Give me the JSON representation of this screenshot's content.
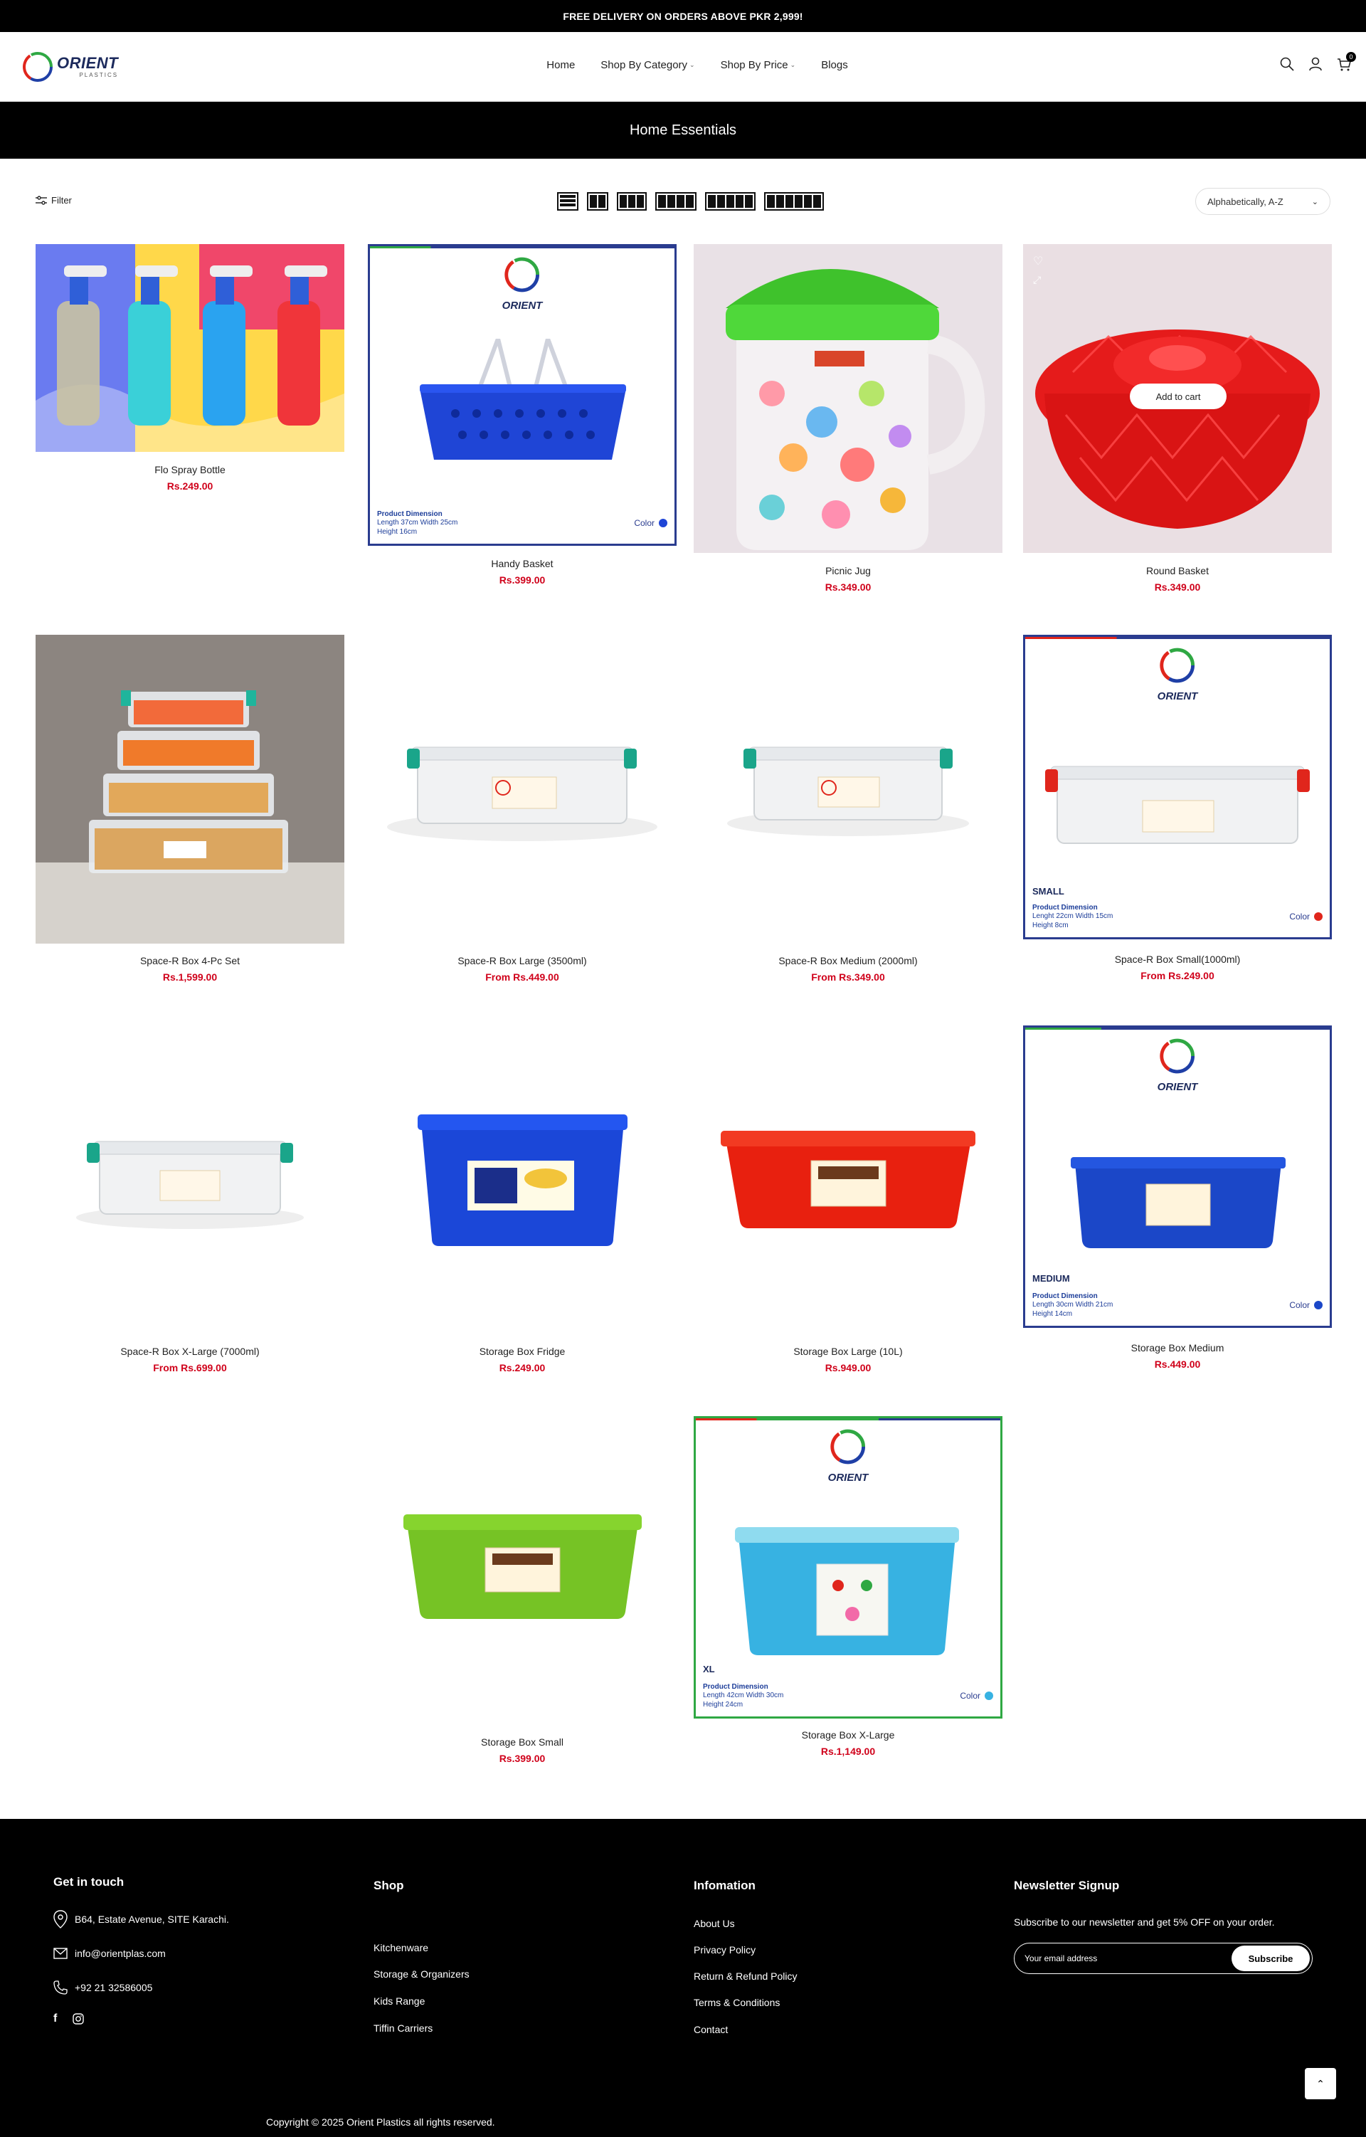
{
  "announcement": "FREE DELIVERY ON ORDERS ABOVE PKR 2,999!",
  "logo": {
    "word": "ORIENT",
    "sub": "PLASTICS"
  },
  "nav": [
    {
      "label": "Home"
    },
    {
      "label": "Shop By Category"
    },
    {
      "label": "Shop By Price"
    },
    {
      "label": "Blogs"
    }
  ],
  "cart_count": "0",
  "collection_title": "Home Essentials",
  "toolbar": {
    "filter_label": "Filter",
    "sort_value": "Alphabetically, A-Z"
  },
  "products": [
    {
      "name": "Flo Spray Bottle",
      "price": "Rs.249.00"
    },
    {
      "name": "Handy Basket",
      "price": "Rs.399.00",
      "dim_title": "Product Dimension",
      "dim_line1": "Length 37cm Width 25cm",
      "dim_line2": "Height 16cm",
      "color_label": "Color"
    },
    {
      "name": "Picnic Jug",
      "price": "Rs.349.00"
    },
    {
      "name": "Round Basket",
      "price": "Rs.349.00",
      "cta": "Add to cart"
    },
    {
      "name": "Space-R Box 4-Pc Set",
      "price": "Rs.1,599.00"
    },
    {
      "name": "Space-R Box Large (3500ml)",
      "price": "From Rs.449.00"
    },
    {
      "name": "Space-R Box Medium (2000ml)",
      "price": "From Rs.349.00"
    },
    {
      "name": "Space-R Box Small(1000ml)",
      "price": "From Rs.249.00",
      "size": "SMALL",
      "dim_title": "Product Dimension",
      "dim_line1": "Lenght 22cm Width 15cm",
      "dim_line2": "Height 8cm",
      "color_label": "Color"
    },
    {
      "name": "Space-R Box X-Large (7000ml)",
      "price": "From Rs.699.00"
    },
    {
      "name": "Storage Box Fridge",
      "price": "Rs.249.00"
    },
    {
      "name": "Storage Box Large (10L)",
      "price": "Rs.949.00"
    },
    {
      "name": "Storage Box Medium",
      "price": "Rs.449.00",
      "size": "MEDIUM",
      "dim_title": "Product Dimension",
      "dim_line1": "Length 30cm Width 21cm",
      "dim_line2": "Height 14cm",
      "color_label": "Color"
    },
    {
      "name": "Storage Box Small",
      "price": "Rs.399.00"
    },
    {
      "name": "Storage Box X-Large",
      "price": "Rs.1,149.00",
      "size": "XL",
      "dim_title": "Product Dimension",
      "dim_line1": "Length 42cm Width 30cm",
      "dim_line2": "Height 24cm",
      "color_label": "Color"
    }
  ],
  "footer": {
    "contact": {
      "title": "Get in touch",
      "address": "B64, Estate Avenue, SITE Karachi.",
      "email": "info@orientplas.com",
      "phone": "+92 21 32586005"
    },
    "shop": {
      "title": "Shop",
      "links": [
        "Kitchenware",
        "Storage & Organizers",
        "Kids Range",
        "Tiffin Carriers"
      ]
    },
    "info": {
      "title": "Infomation",
      "links": [
        "About Us",
        "Privacy Policy",
        "Return & Refund Policy",
        "Terms & Conditions",
        "Contact"
      ]
    },
    "newsletter": {
      "title": "Newsletter Signup",
      "text": "Subscribe to our newsletter and get 5% OFF on your order.",
      "placeholder": "Your email address",
      "button": "Subscribe"
    },
    "copyright": "Copyright © 2025 Orient Plastics all rights reserved."
  },
  "colors": {
    "price_red": "#d0021b",
    "brand_blue": "#1c2a5c"
  }
}
